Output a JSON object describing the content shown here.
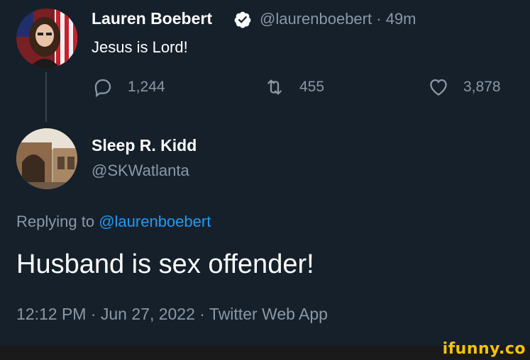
{
  "tweet": {
    "author_name": "Lauren Boebert",
    "verified": true,
    "handle": "@laurenboebert",
    "separator": "·",
    "age": "49m",
    "text": "Jesus is Lord!",
    "actions": {
      "reply_count": "1,244",
      "retweet_count": "455",
      "like_count": "3,878"
    }
  },
  "reply": {
    "author_name": "Sleep R. Kidd",
    "handle": "@SKWatlanta",
    "replying_prefix": "Replying to",
    "replying_to": "@laurenboebert",
    "text": "Husband is sex offender!",
    "meta": "12:12 PM · Jun 27, 2022 · Twitter Web App"
  },
  "watermark": "ifunny.co",
  "colors": {
    "background": "#15202b",
    "muted": "#8b98a5",
    "accent": "#1d9bf0",
    "watermark": "#f5c400"
  },
  "icons": [
    "reply-icon",
    "retweet-icon",
    "like-icon",
    "verified-badge-icon"
  ]
}
